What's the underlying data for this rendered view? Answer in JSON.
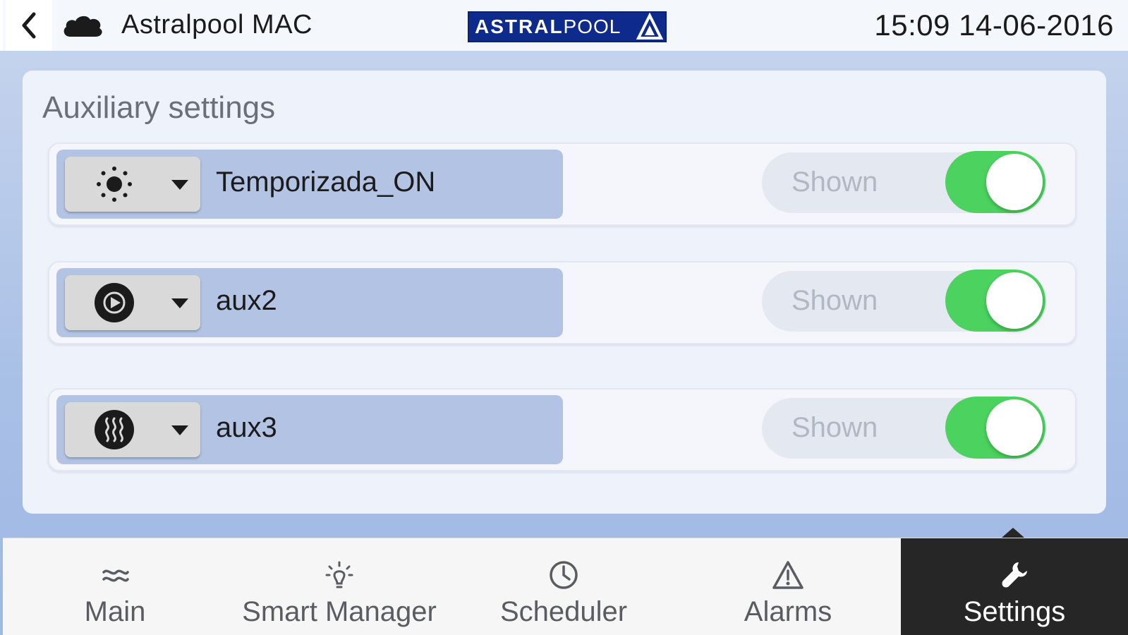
{
  "header": {
    "app_title": "Astralpool MAC",
    "brand_logo_bold": "ASTRAL",
    "brand_logo_light": "POOL",
    "datetime": "15:09 14-06-2016",
    "back_icon": "chevron-left-icon",
    "cloud_icon": "cloud-icon"
  },
  "panel": {
    "title": "Auxiliary settings",
    "rows": [
      {
        "name": "Temporizada_ON",
        "icon": "sun-icon",
        "shown_label": "Shown",
        "shown": true
      },
      {
        "name": "aux2",
        "icon": "pump-icon",
        "shown_label": "Shown",
        "shown": true
      },
      {
        "name": "aux3",
        "icon": "heater-icon",
        "shown_label": "Shown",
        "shown": true
      }
    ]
  },
  "nav": {
    "items": [
      {
        "label": "Main",
        "icon": "waves-icon"
      },
      {
        "label": "Smart Manager",
        "icon": "bulb-icon"
      },
      {
        "label": "Scheduler",
        "icon": "clock-icon"
      },
      {
        "label": "Alarms",
        "icon": "warning-icon"
      },
      {
        "label": "Settings",
        "icon": "wrench-icon"
      }
    ],
    "active": "Settings"
  },
  "colors": {
    "toggle_on": "#4cd35f",
    "name_block": "#b3c3e3",
    "nav_active": "#262626",
    "brand_blue": "#0d2a8c"
  }
}
